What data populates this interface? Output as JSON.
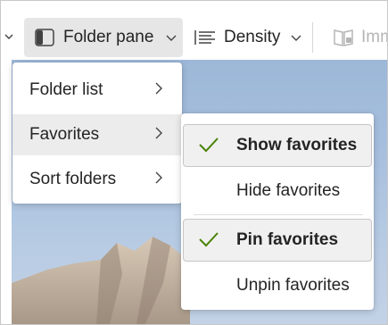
{
  "toolbar": {
    "folder_pane_label": "Folder pane",
    "density_label": "Density",
    "immersive_label": "Imm"
  },
  "folder_menu": {
    "items": [
      {
        "label": "Folder list"
      },
      {
        "label": "Favorites"
      },
      {
        "label": "Sort folders"
      }
    ]
  },
  "favorites_submenu": {
    "items": [
      {
        "label": "Show favorites",
        "checked": true
      },
      {
        "label": "Hide favorites",
        "checked": false
      },
      {
        "label": "Pin favorites",
        "checked": true
      },
      {
        "label": "Unpin favorites",
        "checked": false
      }
    ]
  },
  "colors": {
    "check": "#498205",
    "hover_background": "#ececec",
    "disabled_text": "#b5b5b5"
  }
}
